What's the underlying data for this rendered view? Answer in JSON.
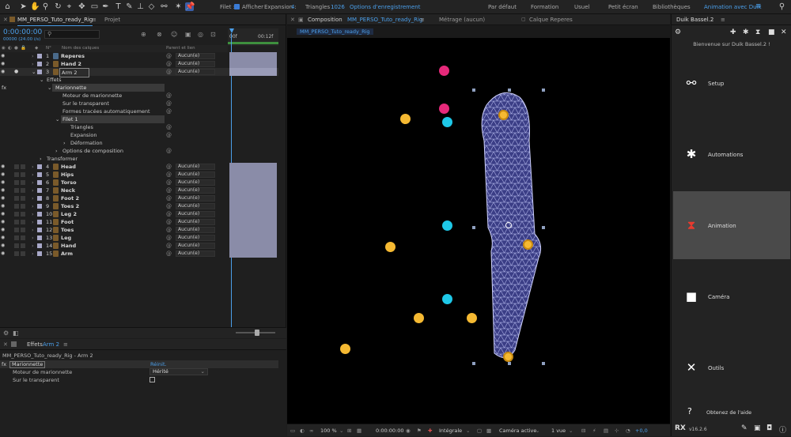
{
  "toolbar": {
    "filet_label": "Filet :",
    "afficher_label": "Afficher",
    "expansion_label": "Expansion :",
    "expansion_value": "4",
    "triangles_label": "Triangles :",
    "triangles_value": "1026",
    "record_options": "Options d'enregistrement",
    "workspaces": [
      "Par défaut",
      "Formation",
      "Usuel",
      "Petit écran",
      "Bibliothèques",
      "Animation avec Duik"
    ]
  },
  "timeline": {
    "tab_label": "MM_PERSO_Tuto_ready_Rig",
    "project_tab": "Projet",
    "timecode": "0:00:00:00",
    "fps": "00000 (24.00 i/s)",
    "search_placeholder": "",
    "col_num": "N°",
    "col_name": "Nom des calques",
    "col_parent": "Parent et lien",
    "ruler_start": "00f",
    "ruler_end": "00:12f",
    "parent_default": "Aucun(e)",
    "layers_top": [
      {
        "num": "1",
        "name": "Reperes"
      },
      {
        "num": "2",
        "name": "Hand 2"
      },
      {
        "num": "3",
        "name": "Arm 2"
      }
    ],
    "tree": {
      "effets": "Effets",
      "marionnette": "Marionnette",
      "moteur": "Moteur de marionnette",
      "sur_transparent": "Sur le transparent",
      "formes": "Formes tracées automatiquement",
      "filet": "Filet 1",
      "triangles": "Triangles",
      "expansion": "Expansion",
      "deformation": "Déformation",
      "options": "Options de composition",
      "transformer": "Transformer"
    },
    "layers_bottom": [
      {
        "num": "4",
        "name": "Head"
      },
      {
        "num": "5",
        "name": "Hips"
      },
      {
        "num": "6",
        "name": "Torso"
      },
      {
        "num": "7",
        "name": "Neck"
      },
      {
        "num": "8",
        "name": "Foot 2"
      },
      {
        "num": "9",
        "name": "Toes 2"
      },
      {
        "num": "10",
        "name": "Leg 2"
      },
      {
        "num": "11",
        "name": "Foot"
      },
      {
        "num": "12",
        "name": "Toes"
      },
      {
        "num": "13",
        "name": "Leg"
      },
      {
        "num": "14",
        "name": "Hand"
      },
      {
        "num": "15",
        "name": "Arm"
      }
    ]
  },
  "effects_panel": {
    "tab_prefix": "Effets",
    "tab_layer": "Arm 2",
    "path": "MM_PERSO_Tuto_ready_Rig - Arm 2",
    "effect_name": "Marionnette",
    "reset": "Réinit.",
    "moteur_label": "Moteur de marionnette",
    "moteur_value": "Hérité",
    "transparent_label": "Sur le transparent"
  },
  "composition": {
    "tab_prefix": "Composition",
    "tab_name": "MM_PERSO_Tuto_ready_Rig",
    "footage_tab": "Métrage (aucun)",
    "layer_tab": "Calque Reperes",
    "breadcrumb": "MM_PERSO_Tuto_ready_Rig",
    "footer": {
      "zoom": "100 %",
      "timecode": "0:00:00:00",
      "quality": "Intégrale",
      "camera": "Caméra active",
      "views": "1 vue",
      "exposure": "+0,0"
    }
  },
  "duik": {
    "title": "Duik Bassel.2",
    "welcome": "Bienvenue sur Duik Bassel.2 !",
    "buttons": [
      {
        "label": "Setup",
        "icon": "bone-icon"
      },
      {
        "label": "Automations",
        "icon": "gears-icon"
      },
      {
        "label": "Animation",
        "icon": "hourglass-icon"
      },
      {
        "label": "Caméra",
        "icon": "camera-icon"
      },
      {
        "label": "Outils",
        "icon": "tools-icon"
      }
    ],
    "help": "Obtenez de l'aide",
    "version": "v16.2.6"
  },
  "colors": {
    "accent_blue": "#4b9fea",
    "magenta": "#e6297a",
    "cyan": "#1ec8e8",
    "yellow": "#f5b932",
    "animation_red": "#e83a2e"
  }
}
